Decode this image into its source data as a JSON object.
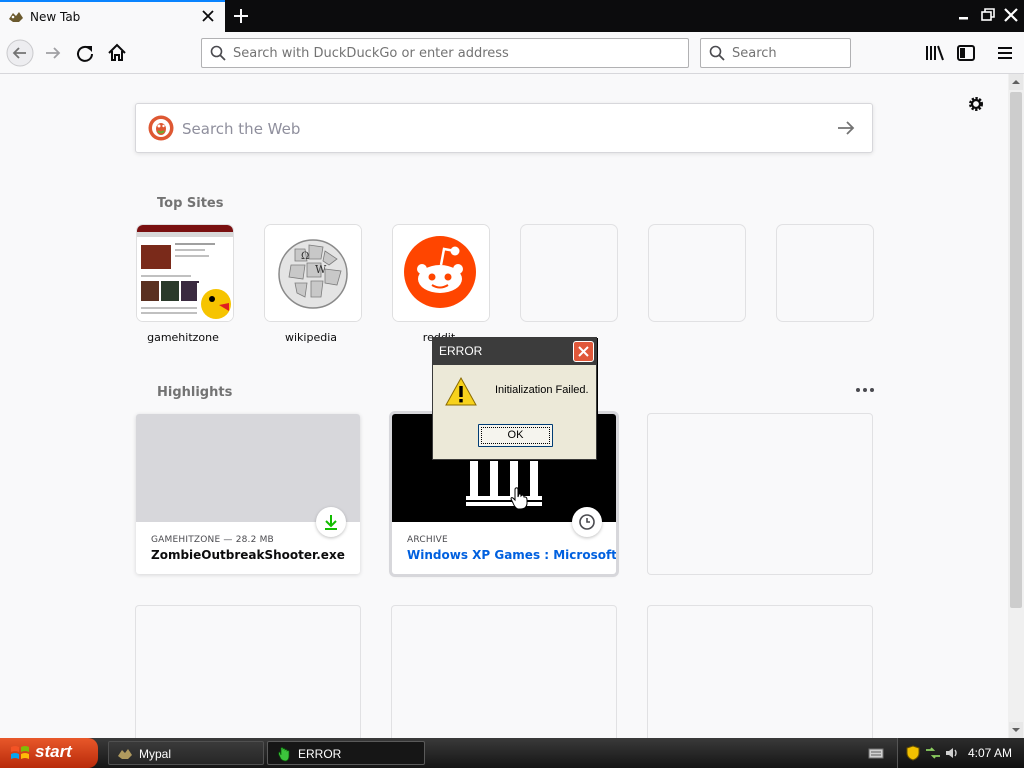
{
  "browser": {
    "tab": {
      "title": "New Tab"
    },
    "urlbar": {
      "placeholder": "Search with DuckDuckGo or enter address"
    },
    "searchbar": {
      "placeholder": "Search"
    }
  },
  "newtab": {
    "websearch_placeholder": "Search the Web",
    "top_sites_title": "Top Sites",
    "top_sites": [
      {
        "label": "gamehitzone"
      },
      {
        "label": "wikipedia"
      },
      {
        "label": "reddit"
      }
    ],
    "highlights_title": "Highlights",
    "highlights": [
      {
        "meta": "GAMEHITZONE — 28.2 MB",
        "title": "ZombieOutbreakShooter.exe",
        "badge_icon": "download-icon"
      },
      {
        "meta": "ARCHIVE",
        "title": "Windows XP Games : Microsoft ...",
        "badge_icon": "clock-icon"
      }
    ]
  },
  "dialog": {
    "title": "ERROR",
    "message": "Initialization Failed.",
    "ok_label": "OK"
  },
  "taskbar": {
    "start_label": "start",
    "items": [
      {
        "label": "Mypal"
      },
      {
        "label": "ERROR"
      }
    ],
    "clock": "4:07 AM"
  },
  "colors": {
    "accent": "#0a84ff",
    "reddit": "#ff4500",
    "download_green": "#12bc00",
    "archive_title": "#0060df",
    "start_orange": "#d9461a"
  }
}
